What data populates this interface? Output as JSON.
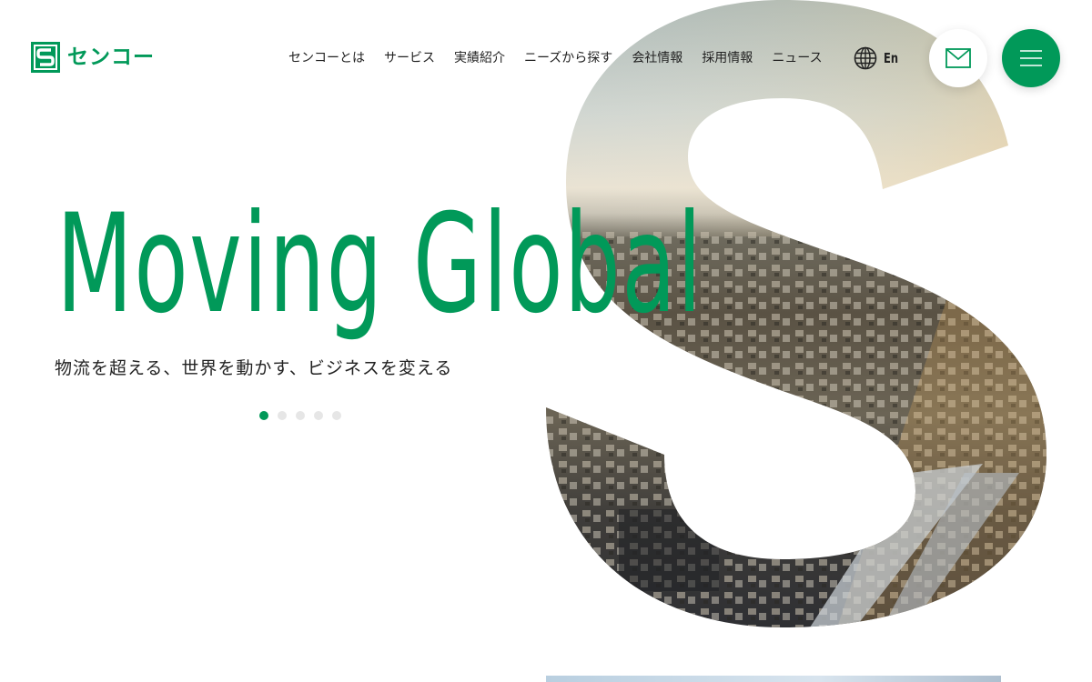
{
  "brand": {
    "logo_text": "センコー",
    "accent_color": "#019959",
    "logo_icon": "senko-logo-mark"
  },
  "nav": {
    "items": [
      {
        "label": "センコーとは"
      },
      {
        "label": "サービス"
      },
      {
        "label": "実績紹介"
      },
      {
        "label": "ニーズから探す"
      },
      {
        "label": "会社情報"
      },
      {
        "label": "採用情報"
      },
      {
        "label": "ニュース"
      }
    ]
  },
  "language": {
    "label": "En",
    "icon": "globe-icon"
  },
  "actions": {
    "mail_icon": "mail-icon",
    "menu_icon": "hamburger-menu-icon"
  },
  "hero": {
    "title": "Moving Global",
    "subtitle": "物流を超える、世界を動かす、ビジネスを変える",
    "image_description_icon": "city-aerial-image",
    "slides_total": 5,
    "active_slide": 1
  }
}
